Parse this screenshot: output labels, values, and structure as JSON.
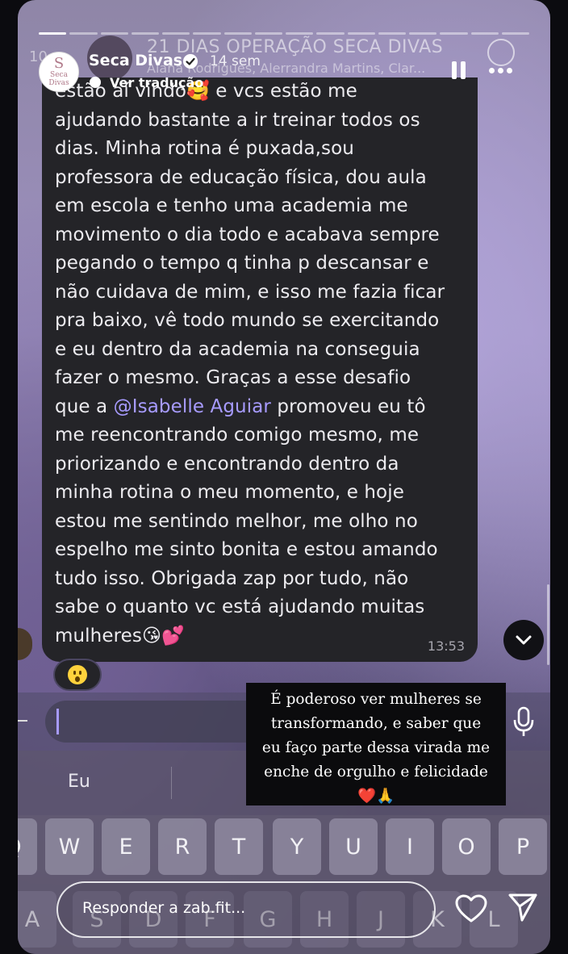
{
  "background_chat": {
    "count": "10",
    "title": "21 DIAS OPERAÇÃO SECA DIVAS",
    "members": "Alana Rodrigues, Alerrandra Martins, Clar..."
  },
  "story": {
    "progress": {
      "total": 16,
      "completed": 1
    },
    "avatar": {
      "monogram": "S",
      "line1": "Seca",
      "line2": "Divas"
    },
    "username": "Seca Divas",
    "time": "14 sem",
    "translate": "Ver tradução"
  },
  "message": {
    "line01": "estão aí vindo🥰 e vcs estão me",
    "line02": "ajudando bastante a ir treinar todos os",
    "line03": "dias. Minha rotina é puxada,sou",
    "line04": "professora de educação física, dou aula",
    "line05": "em escola e tenho uma academia me",
    "line06": "movimento o dia todo e acabava sempre",
    "line07": "pegando o tempo q tinha p descansar e",
    "line08": "não cuidava de mim, e isso me fazia ficar",
    "line09": "pra baixo, vê todo mundo se exercitando",
    "line10": "e eu dentro da academia na conseguia",
    "line11": "fazer o mesmo. Graças a esse desafio",
    "line12_pre": "que a ",
    "mention": "@Isabelle Aguiar",
    "line12_post": " promoveu eu tô",
    "line13": "me reencontrando comigo mesmo, me",
    "line14": "priorizando e encontrando dentro da",
    "line15": "minha rotina o meu momento, e hoje",
    "line16": "estou me sentindo melhor, me olho no",
    "line17": "espelho me sinto bonita e estou amando",
    "line18": "tudo isso. Obrigada zap por tudo, não",
    "line19": "sabe o quanto vc está ajudando muitas",
    "line20": "mulheres😘💕",
    "timestamp": "13:53"
  },
  "suggestion": "Eu",
  "keys_row1": [
    "Q",
    "W",
    "E",
    "R",
    "T",
    "Y",
    "U",
    "I",
    "O",
    "P"
  ],
  "keys_row2": [
    "A",
    "S",
    "D",
    "F",
    "G",
    "H",
    "J",
    "K",
    "L"
  ],
  "caption": {
    "line1": "É poderoso ver mulheres se",
    "line2": "transformando, e saber que",
    "line3": "eu faço parte dessa virada me",
    "line4": "enche de orgulho e felicidade",
    "line5": "❤️🙏"
  },
  "reply_placeholder": "Responder a zab.fit..."
}
